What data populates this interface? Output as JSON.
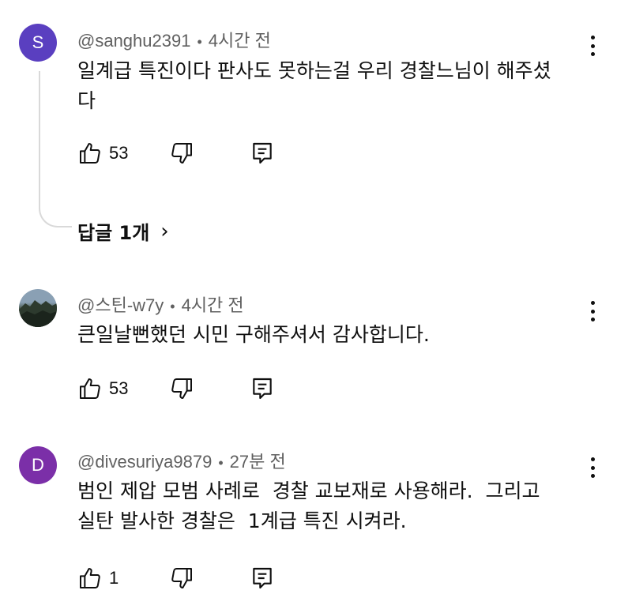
{
  "comments": [
    {
      "avatar_letter": "S",
      "avatar_color": "#5a3fc0",
      "username": "@sanghu2391",
      "time": "4시간 전",
      "text": "일계급 특진이다 판사도 못하는걸 우리 경찰느님이 해주셨\n다",
      "likes": "53"
    },
    {
      "avatar_letter": "",
      "avatar_image": "mountain-photo",
      "username": "@스틴-w7y",
      "time": "4시간 전",
      "text": "큰일날뻔했던 시민 구해주셔서 감사합니다.",
      "likes": "53"
    },
    {
      "avatar_letter": "D",
      "avatar_color": "#7b2fa8",
      "username": "@divesuriya9879",
      "time": "27분 전",
      "text": "범인 제압 모범 사례로  경찰 교보재로 사용해라.  그리고\n실탄 발사한 경찰은  1계급 특진 시켜라.",
      "likes": "1"
    }
  ],
  "replies": {
    "label": "답글 1개"
  },
  "icons": {
    "like": "thumbs-up-icon",
    "dislike": "thumbs-down-icon",
    "reply": "reply-icon",
    "more": "more-vert-icon",
    "replies_chevron": "chevron-right-icon"
  }
}
